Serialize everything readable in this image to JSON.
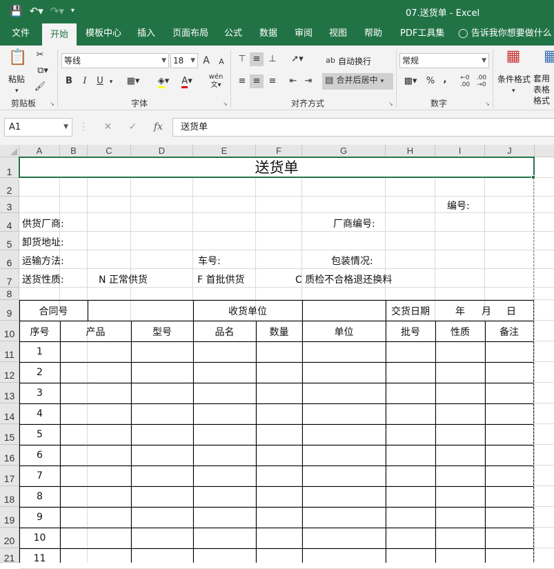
{
  "titlebar": {
    "doc_title": "07.送货单  -  Excel"
  },
  "tabs": [
    "文件",
    "开始",
    "模板中心",
    "插入",
    "页面布局",
    "公式",
    "数据",
    "审阅",
    "视图",
    "帮助",
    "PDF工具集",
    "告诉我你想要做什么"
  ],
  "ribbon": {
    "clipboard": {
      "paste": "粘贴",
      "label": "剪贴板"
    },
    "font": {
      "name": "等线",
      "size": "18",
      "label": "字体",
      "bold": "B",
      "italic": "I",
      "underline": "U",
      "grow": "A",
      "shrink": "A",
      "color_a": "A",
      "phonetic": "wén"
    },
    "alignment": {
      "wrap": "自动换行",
      "merge": "合并后居中",
      "label": "对齐方式"
    },
    "number": {
      "format": "常规",
      "percent": "%",
      "comma": ",",
      "label": "数字"
    },
    "styles": {
      "conditional": "条件格式",
      "table": "套用表格格式"
    }
  },
  "formula_bar": {
    "name_box": "A1",
    "fx": "fx",
    "content": "送货单"
  },
  "columns": [
    "A",
    "B",
    "C",
    "D",
    "E",
    "F",
    "G",
    "H",
    "I",
    "J"
  ],
  "rows": [
    "1",
    "2",
    "3",
    "4",
    "5",
    "6",
    "7",
    "8",
    "9",
    "10",
    "11",
    "12",
    "13",
    "14",
    "15",
    "16",
    "17",
    "18",
    "19",
    "20",
    "21"
  ],
  "sheet": {
    "title": "送货单",
    "number_label": "编号:",
    "supplier_label": "供货厂商:",
    "factory_no_label": "厂商编号:",
    "unload_addr_label": "卸货地址:",
    "transport_label": "运输方法:",
    "vehicle_label": "车号:",
    "packing_label": "包装情况:",
    "delivery_type_label": "送货性质:",
    "type_n": "N 正常供货",
    "type_f": "F  首批供货",
    "type_c": "C 质检不合格退还换料",
    "contract_no": "合同号",
    "receiver": "收货单位",
    "delivery_date": "交货日期",
    "year": "年",
    "month": "月",
    "day": "日",
    "headers": [
      "序号",
      "产品",
      "型号",
      "品名",
      "数量",
      "单位",
      "批号",
      "性质",
      "备注"
    ],
    "seq": [
      "1",
      "2",
      "3",
      "4",
      "5",
      "6",
      "7",
      "8",
      "9",
      "10",
      "11"
    ]
  }
}
